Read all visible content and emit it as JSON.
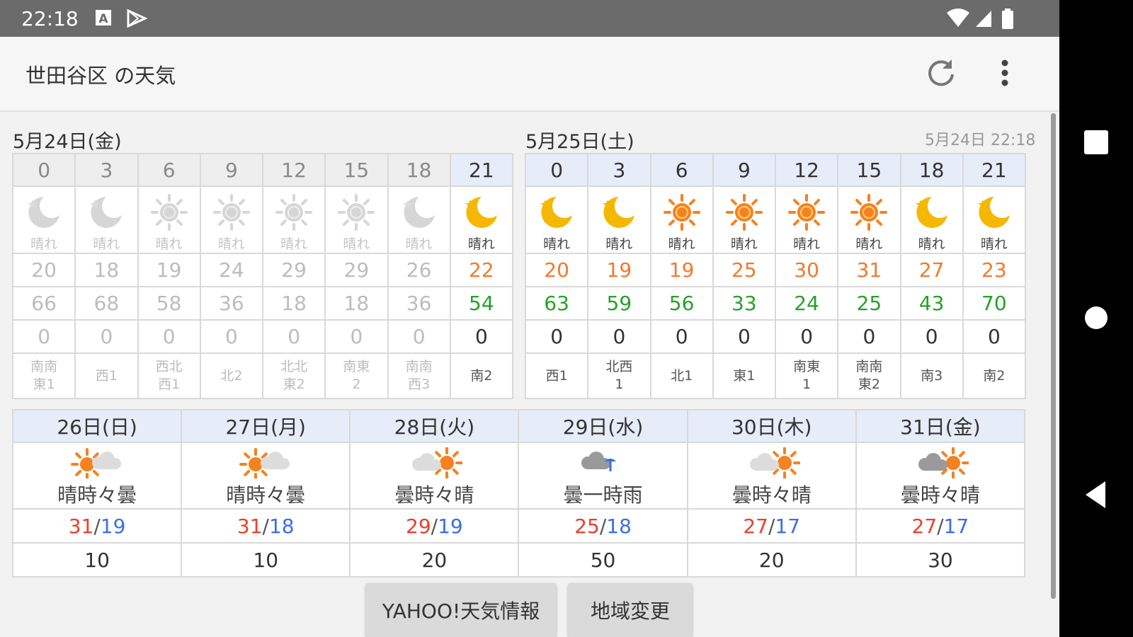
{
  "status_bar": {
    "time": "22:18"
  },
  "app_bar": {
    "title": "世田谷区 の天気"
  },
  "colors": {
    "hi": "#e8402c",
    "lo": "#3a6fe0",
    "temp": "#f07a2c",
    "humidity": "#28a028",
    "header_blue": "#e6ecf8"
  },
  "today": {
    "label": "5月24日(金)",
    "hours": [
      {
        "hour": "0",
        "icon": "moon",
        "cond": "晴れ",
        "temp": "20",
        "hum": "66",
        "prec": "0",
        "wind": [
          "南南",
          "東1"
        ],
        "past": true
      },
      {
        "hour": "3",
        "icon": "moon",
        "cond": "晴れ",
        "temp": "18",
        "hum": "68",
        "prec": "0",
        "wind": [
          "西1"
        ],
        "past": true
      },
      {
        "hour": "6",
        "icon": "sun",
        "cond": "晴れ",
        "temp": "19",
        "hum": "58",
        "prec": "0",
        "wind": [
          "西北",
          "西1"
        ],
        "past": true
      },
      {
        "hour": "9",
        "icon": "sun",
        "cond": "晴れ",
        "temp": "24",
        "hum": "36",
        "prec": "0",
        "wind": [
          "北2"
        ],
        "past": true
      },
      {
        "hour": "12",
        "icon": "sun",
        "cond": "晴れ",
        "temp": "29",
        "hum": "18",
        "prec": "0",
        "wind": [
          "北北",
          "東2"
        ],
        "past": true
      },
      {
        "hour": "15",
        "icon": "sun",
        "cond": "晴れ",
        "temp": "29",
        "hum": "18",
        "prec": "0",
        "wind": [
          "南東",
          "2"
        ],
        "past": true
      },
      {
        "hour": "18",
        "icon": "moon",
        "cond": "晴れ",
        "temp": "26",
        "hum": "36",
        "prec": "0",
        "wind": [
          "南南",
          "西3"
        ],
        "past": true
      },
      {
        "hour": "21",
        "icon": "moon",
        "cond": "晴れ",
        "temp": "22",
        "hum": "54",
        "prec": "0",
        "wind": [
          "南2"
        ],
        "past": false
      }
    ]
  },
  "tomorrow": {
    "label": "5月25日(土)",
    "updated": "5月24日 22:18",
    "hours": [
      {
        "hour": "0",
        "icon": "moon",
        "cond": "晴れ",
        "temp": "20",
        "hum": "63",
        "prec": "0",
        "wind": [
          "西1"
        ],
        "past": false
      },
      {
        "hour": "3",
        "icon": "moon",
        "cond": "晴れ",
        "temp": "19",
        "hum": "59",
        "prec": "0",
        "wind": [
          "北西",
          "1"
        ],
        "past": false
      },
      {
        "hour": "6",
        "icon": "sun",
        "cond": "晴れ",
        "temp": "19",
        "hum": "56",
        "prec": "0",
        "wind": [
          "北1"
        ],
        "past": false
      },
      {
        "hour": "9",
        "icon": "sun",
        "cond": "晴れ",
        "temp": "25",
        "hum": "33",
        "prec": "0",
        "wind": [
          "東1"
        ],
        "past": false
      },
      {
        "hour": "12",
        "icon": "sun",
        "cond": "晴れ",
        "temp": "30",
        "hum": "24",
        "prec": "0",
        "wind": [
          "南東",
          "1"
        ],
        "past": false
      },
      {
        "hour": "15",
        "icon": "sun",
        "cond": "晴れ",
        "temp": "31",
        "hum": "25",
        "prec": "0",
        "wind": [
          "南南",
          "東2"
        ],
        "past": false
      },
      {
        "hour": "18",
        "icon": "moon",
        "cond": "晴れ",
        "temp": "27",
        "hum": "43",
        "prec": "0",
        "wind": [
          "南3"
        ],
        "past": false
      },
      {
        "hour": "21",
        "icon": "moon",
        "cond": "晴れ",
        "temp": "23",
        "hum": "70",
        "prec": "0",
        "wind": [
          "南2"
        ],
        "past": false
      }
    ]
  },
  "weekly": [
    {
      "date": "26日(日)",
      "icon": "sun-cloud",
      "cond": "晴時々曇",
      "hi": "31",
      "lo": "19",
      "rain": "10"
    },
    {
      "date": "27日(月)",
      "icon": "sun-cloud",
      "cond": "晴時々曇",
      "hi": "31",
      "lo": "18",
      "rain": "10"
    },
    {
      "date": "28日(火)",
      "icon": "cloud-sun",
      "cond": "曇時々晴",
      "hi": "29",
      "lo": "19",
      "rain": "20"
    },
    {
      "date": "29日(水)",
      "icon": "cloud-umbrella",
      "cond": "曇一時雨",
      "hi": "25",
      "lo": "18",
      "rain": "50"
    },
    {
      "date": "30日(木)",
      "icon": "cloud-sun",
      "cond": "曇時々晴",
      "hi": "27",
      "lo": "17",
      "rain": "20"
    },
    {
      "date": "31日(金)",
      "icon": "darkcloud-sun",
      "cond": "曇時々晴",
      "hi": "27",
      "lo": "17",
      "rain": "30"
    }
  ],
  "buttons": {
    "yahoo": "YAHOO!天気情報",
    "region": "地域変更"
  }
}
